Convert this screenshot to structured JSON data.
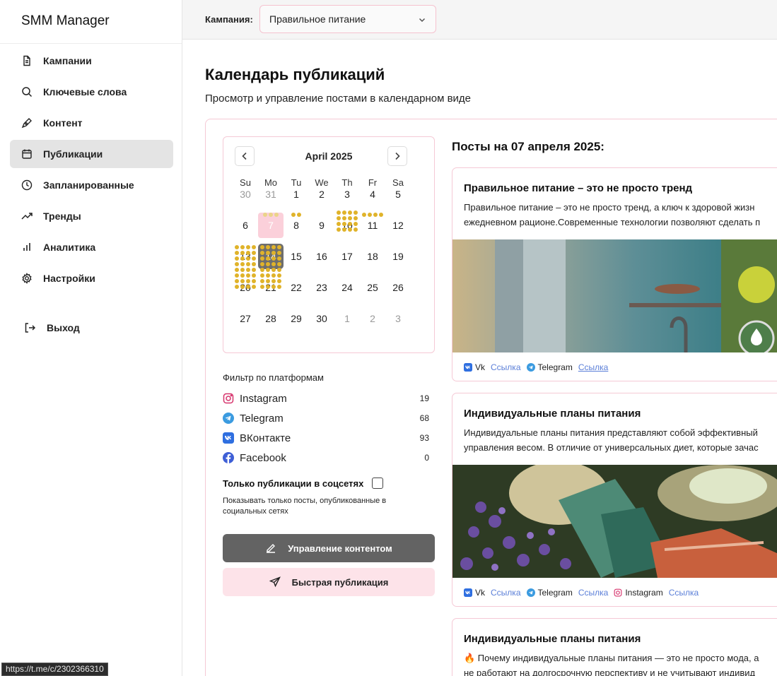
{
  "app": {
    "title": "SMM Manager"
  },
  "nav": {
    "items": [
      {
        "label": "Кампании",
        "icon": "document-icon"
      },
      {
        "label": "Ключевые слова",
        "icon": "search-icon"
      },
      {
        "label": "Контент",
        "icon": "pen-icon"
      },
      {
        "label": "Публикации",
        "icon": "calendar-icon",
        "active": true
      },
      {
        "label": "Запланированные",
        "icon": "clock-icon"
      },
      {
        "label": "Тренды",
        "icon": "trending-icon"
      },
      {
        "label": "Аналитика",
        "icon": "bar-chart-icon"
      },
      {
        "label": "Настройки",
        "icon": "gear-icon"
      }
    ],
    "logout": "Выход"
  },
  "topbar": {
    "campaign_label": "Кампания:",
    "campaign_value": "Правильное питание"
  },
  "page": {
    "title": "Календарь публикаций",
    "subtitle": "Просмотр и управление постами в календарном виде"
  },
  "calendar": {
    "month": "April 2025",
    "weekdays": [
      "Su",
      "Mo",
      "Tu",
      "We",
      "Th",
      "Fr",
      "Sa"
    ],
    "weeks": [
      [
        "30",
        "31",
        "1",
        "2",
        "3",
        "4",
        "5"
      ],
      [
        "6",
        "7",
        "8",
        "9",
        "10",
        "11",
        "12"
      ],
      [
        "13",
        "14",
        "15",
        "16",
        "17",
        "18",
        "19"
      ],
      [
        "20",
        "21",
        "22",
        "23",
        "24",
        "25",
        "26"
      ],
      [
        "27",
        "28",
        "29",
        "30",
        "1",
        "2",
        "3"
      ]
    ],
    "today": "7",
    "selected": "14",
    "colors": {
      "dot": "#e0b32a",
      "selected_bg": "#6e6e6e",
      "today_bg": "#fbd0da"
    }
  },
  "filters": {
    "title": "Фильтр по платформам",
    "platforms": [
      {
        "name": "Instagram",
        "count": "19",
        "icon": "instagram-icon"
      },
      {
        "name": "Telegram",
        "count": "68",
        "icon": "telegram-icon"
      },
      {
        "name": "ВКонтакте",
        "count": "93",
        "icon": "vk-icon"
      },
      {
        "name": "Facebook",
        "count": "0",
        "icon": "facebook-icon"
      }
    ],
    "only_published_label": "Только публикации в соцсетях",
    "only_published_desc": "Показывать только посты, опубликованные в социальных сетях"
  },
  "buttons": {
    "manage": "Управление контентом",
    "quick": "Быстрая публикация"
  },
  "posts": {
    "heading": "Посты на 07 апреля 2025:",
    "items": [
      {
        "title": "Правильное питание – это не просто тренд",
        "line1": "Правильное питание – это не просто тренд, а ключ к здоровой жизн",
        "line2": "ежедневном рационе.Современные технологии позволяют сделать п",
        "links": [
          {
            "platform": "Vk",
            "link": "Ссылка"
          },
          {
            "platform": "Telegram",
            "link": "Ссылка"
          }
        ]
      },
      {
        "title": "Индивидуальные планы питания",
        "line1": "Индивидуальные планы питания представляют собой эффективный",
        "line2": "управления весом. В отличие от универсальных диет, которые зачас",
        "links": [
          {
            "platform": "Vk",
            "link": "Ссылка"
          },
          {
            "platform": "Telegram",
            "link": "Ссылка"
          },
          {
            "platform": "Instagram",
            "link": "Ссылка"
          }
        ]
      },
      {
        "title": "Индивидуальные планы питания",
        "line1": "🔥 Почему индивидуальные планы питания — это не просто мода, а",
        "line2": "не работают на долгосрочную перспективу и не учитывают индивид"
      }
    ]
  },
  "status_bar": {
    "url": "https://t.me/c/2302366310"
  }
}
